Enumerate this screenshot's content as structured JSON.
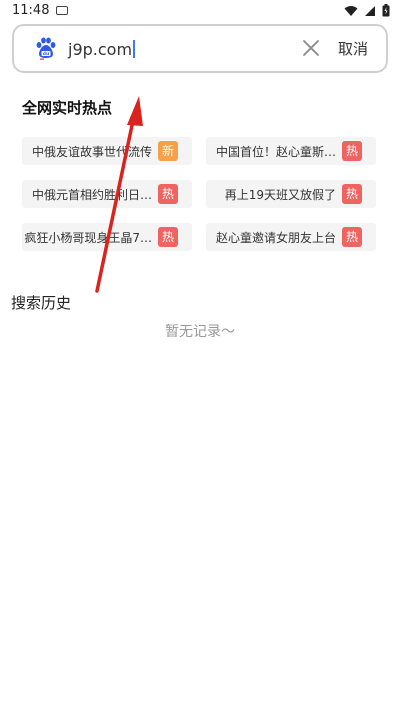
{
  "status_bar": {
    "time": "11:48"
  },
  "search": {
    "query": "j9p.com",
    "cancel_label": "取消"
  },
  "hot": {
    "title": "全网实时热点",
    "items": [
      {
        "text": "中俄友谊故事世代流传",
        "badge": "新",
        "badge_color": "#f5a04a"
      },
      {
        "text": "中国首位！赵心童斯…",
        "badge": "热",
        "badge_color": "#ef6461"
      },
      {
        "text": "中俄元首相约胜利日…",
        "badge": "热",
        "badge_color": "#ef6461"
      },
      {
        "text": "再上19天班又放假了",
        "badge": "热",
        "badge_color": "#ef6461"
      },
      {
        "text": "疯狂小杨哥现身王晶7…",
        "badge": "热",
        "badge_color": "#ef6461"
      },
      {
        "text": "赵心童邀请女朋友上台",
        "badge": "热",
        "badge_color": "#ef6461"
      }
    ]
  },
  "history": {
    "title": "搜索历史",
    "empty_text": "暂无记录～"
  },
  "colors": {
    "annotation_arrow": "#d9231f",
    "caret": "#3b7cf5"
  }
}
